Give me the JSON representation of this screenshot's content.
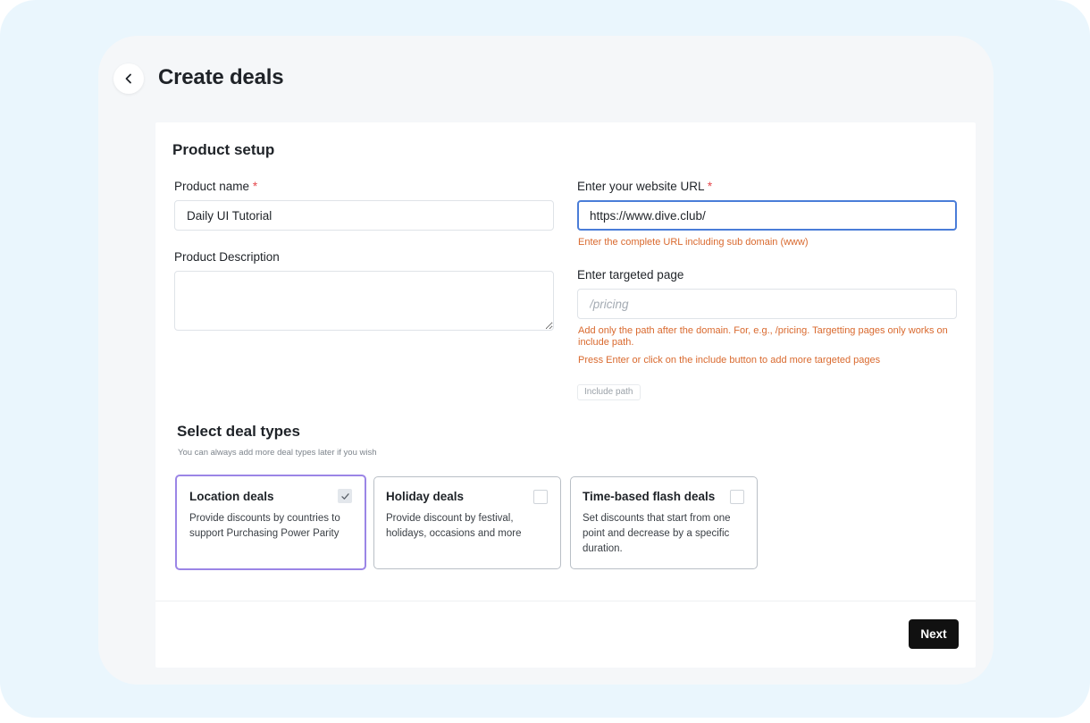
{
  "header": {
    "title": "Create deals"
  },
  "product_setup": {
    "title": "Product setup",
    "product_name": {
      "label": "Product name",
      "required_mark": "*",
      "value": "Daily UI Tutorial"
    },
    "product_description": {
      "label": "Product Description",
      "value": ""
    },
    "website_url": {
      "label": "Enter your website URL",
      "required_mark": "*",
      "value": "https://www.dive.club/",
      "help": "Enter the complete URL including sub domain (www)"
    },
    "targeted_page": {
      "label": "Enter targeted page",
      "placeholder": "/pricing",
      "help_1": "Add only the path after the domain. For, e.g., /pricing. Targetting pages only works on include path.",
      "help_2": "Press Enter or click on the include button to add more targeted pages",
      "include_label": "Include path"
    }
  },
  "deal_types": {
    "title": "Select deal types",
    "subtitle": "You can always add more deal types later if you wish",
    "cards": [
      {
        "title": "Location deals",
        "description": "Provide discounts by countries to support Purchasing Power Parity",
        "selected": true
      },
      {
        "title": "Holiday deals",
        "description": "Provide discount by festival, holidays, occasions and more",
        "selected": false
      },
      {
        "title": "Time-based flash deals",
        "description": "Set discounts that start from one point and decrease by a specific duration.",
        "selected": false
      }
    ]
  },
  "footer": {
    "next_label": "Next"
  },
  "colors": {
    "accent_selected": "#9b85e6",
    "focus_border": "#4a7dd8",
    "help_text": "#d9692e",
    "required": "#e5484d",
    "primary_button": "#111111"
  }
}
